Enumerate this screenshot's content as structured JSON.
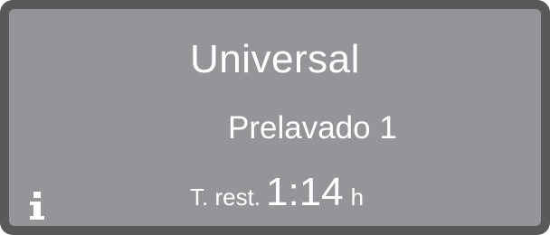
{
  "display": {
    "program": "Universal",
    "phase": "Prelavado 1",
    "time_label": "T. rest.",
    "time_value": "1:14",
    "time_unit": "h",
    "info_icon": "info-icon"
  },
  "colors": {
    "bezel": "#58595b",
    "screen": "#949599",
    "text": "#ffffff"
  }
}
